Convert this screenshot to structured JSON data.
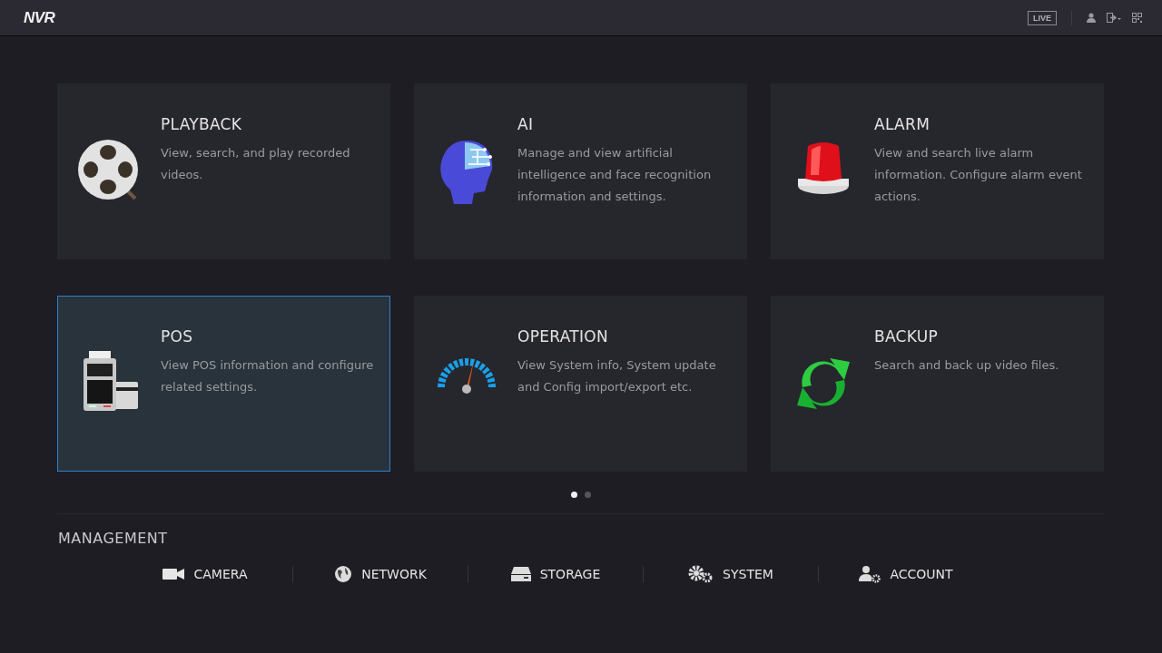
{
  "header": {
    "logo": "NVR",
    "live_button": "LIVE"
  },
  "modules": [
    {
      "kind": "playback",
      "title": "PLAYBACK",
      "description": "View, search, and play recorded videos.",
      "selected": false
    },
    {
      "kind": "ai",
      "title": "AI",
      "description": "Manage and view artificial intelligence and face recognition information and settings.",
      "selected": false
    },
    {
      "kind": "alarm",
      "title": "ALARM",
      "description": "View and search live alarm information. Configure alarm event actions.",
      "selected": false
    },
    {
      "kind": "pos",
      "title": "POS",
      "description": "View POS information and configure related settings.",
      "selected": true
    },
    {
      "kind": "operation",
      "title": "OPERATION",
      "description": "View System info, System update and Config import/export etc.",
      "selected": false
    },
    {
      "kind": "backup",
      "title": "BACKUP",
      "description": "Search and back up video files.",
      "selected": false
    }
  ],
  "pager": [
    {
      "selected": true
    },
    {
      "selected": false
    }
  ],
  "management": {
    "title": "MANAGEMENT",
    "items": [
      {
        "kind": "camera",
        "label": "CAMERA"
      },
      {
        "kind": "network",
        "label": "NETWORK"
      },
      {
        "kind": "storage",
        "label": "STORAGE"
      },
      {
        "kind": "system",
        "label": "SYSTEM"
      },
      {
        "kind": "account",
        "label": "ACCOUNT"
      }
    ]
  }
}
